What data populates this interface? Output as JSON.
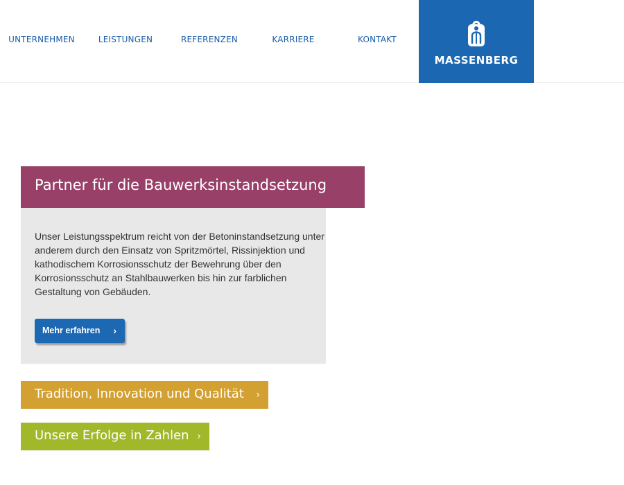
{
  "nav": {
    "items": [
      {
        "label": "UNTERNEHMEN"
      },
      {
        "label": "LEISTUNGEN"
      },
      {
        "label": "REFERENZEN"
      },
      {
        "label": "KARRIERE"
      },
      {
        "label": "KONTAKT"
      }
    ]
  },
  "logo": {
    "text": "MASSENBERG",
    "icon": "massenberg-emblem-icon"
  },
  "hero": {
    "title": "Partner für die Bauwerksinstandsetzung",
    "body": "Unser Leistungsspektrum reicht von der Betoninstandsetzung unter anderem durch den Einsatz von Spritzmörtel, Rissinjektion und kathodischem Korrosionsschutz der Bewehrung über den Korrosionsschutz an Stahlbauwerken bis hin zur farblichen Gestaltung von Gebäuden.",
    "button_label": "Mehr erfahren"
  },
  "links": {
    "tradition_label": "Tradition, Innovation und Qualität",
    "zahlen_label": "Unsere Erfolge in Zahlen"
  },
  "icons": {
    "chevron": "›",
    "chevron_name": "chevron-right-icon"
  },
  "colors": {
    "brand_blue": "#1c67b1",
    "nav_text": "#1a5ea8",
    "hero_title_bg": "#994068",
    "hero_body_bg": "#e8e8e8",
    "tradition_bg": "#d3a032",
    "zahlen_bg": "#a1b82b"
  }
}
